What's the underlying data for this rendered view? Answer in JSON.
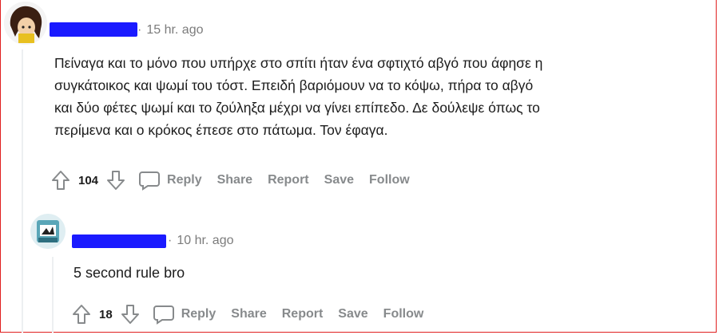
{
  "comment": {
    "timestamp": "15 hr. ago",
    "text_lines": [
      "Πείναγα και το μόνο που υπήρχε στο σπίτι ήταν ένα σφτιχτό αβγό που άφησε η",
      "συγκάτοικος και ψωμί του τόστ. Επειδή βαριόμουν να το κόψω, πήρα το αβγό",
      "και δύο φέτες ψωμί και το ζούληξα μέχρι να γίνει επίπεδο. Δε δούλεψε όπως το",
      "περίμενα και ο κρόκος έπεσε στο πάτωμα. Τον έφαγα."
    ],
    "votes": "104",
    "actions": {
      "reply": "Reply",
      "share": "Share",
      "report": "Report",
      "save": "Save",
      "follow": "Follow"
    }
  },
  "reply": {
    "timestamp": "10 hr. ago",
    "text": "5 second rule bro",
    "votes": "18",
    "actions": {
      "reply": "Reply",
      "share": "Share",
      "report": "Report",
      "save": "Save",
      "follow": "Follow"
    }
  },
  "colors": {
    "redaction": "#1a1aff",
    "border": "#e02020",
    "meta": "#7c7c7c",
    "action": "#878a8c"
  },
  "icons": [
    "upvote-icon",
    "downvote-icon",
    "reply-bubble-icon"
  ]
}
